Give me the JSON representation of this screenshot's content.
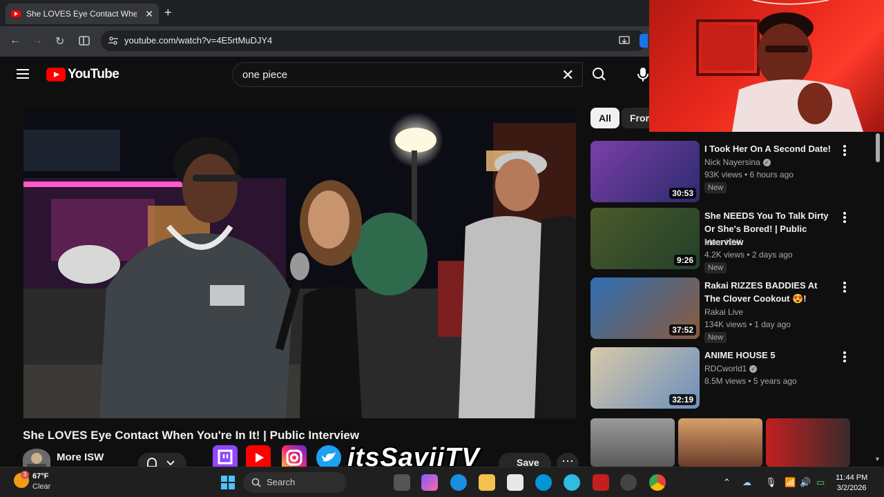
{
  "browser": {
    "tab_title": "She LOVES Eye Contact When Y",
    "tab_close": "✕",
    "new_tab": "+",
    "url": "youtube.com/watch?v=4E5rtMuDJY4",
    "back": "←",
    "forward": "→",
    "reload": "↻"
  },
  "youtube": {
    "logo_text": "YouTube",
    "search_value": "one piece",
    "search_clear": "✕"
  },
  "video": {
    "title": "She LOVES Eye Contact When You're In It! | Public Interview",
    "channel": "More ISW",
    "save_label": "Save",
    "more_actions": "⋯"
  },
  "chips": [
    {
      "label": "All"
    },
    {
      "label": "From"
    }
  ],
  "recommendations": [
    {
      "title": "I Took Her On A Second Date!",
      "channel": "Nick Nayersina",
      "verified": true,
      "meta": "93K views • 6 hours ago",
      "badge": "New",
      "duration": "30:53",
      "thumb_colors": [
        "#7b3fa8",
        "#2c2b6e"
      ]
    },
    {
      "title": "She NEEDS You To Talk Dirty Or She's Bored! | Public Interview",
      "channel": "More ISW",
      "verified": false,
      "meta": "4.2K views • 2 days ago",
      "badge": "New",
      "duration": "9:26",
      "thumb_colors": [
        "#4a5a2a",
        "#23402a"
      ]
    },
    {
      "title": "Rakai RIZZES BADDIES At The Clover Cookout 😍!",
      "channel": "Rakai Live",
      "verified": false,
      "meta": "134K views • 1 day ago",
      "badge": "New",
      "duration": "37:52",
      "thumb_colors": [
        "#2f6fb3",
        "#8a5a3c"
      ]
    },
    {
      "title": "ANIME HOUSE 5",
      "channel": "RDCworld1",
      "verified": true,
      "meta": "8.5M views • 5 years ago",
      "badge": "",
      "duration": "32:19",
      "thumb_colors": [
        "#d9c9a8",
        "#6a8fbd"
      ]
    }
  ],
  "overlay": {
    "handle": "itsSaviiTV"
  },
  "taskbar": {
    "weather_badge": "3",
    "temperature": "67°F",
    "condition": "Clear",
    "search_label": "Search",
    "time": "11:44 PM",
    "date": "3/2/2026"
  }
}
